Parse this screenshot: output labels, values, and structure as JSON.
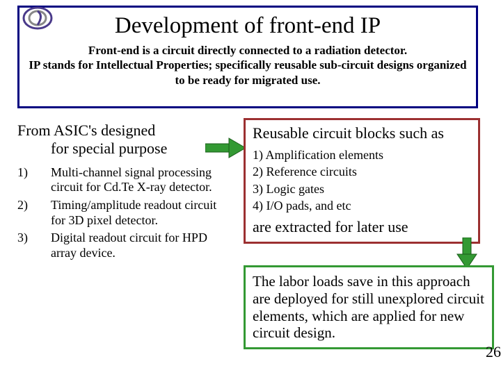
{
  "title": "Development of front-end IP",
  "subtitle": "Front-end is a circuit directly connected to a radiation detector.\nIP stands for Intellectual Properties; specifically reusable sub-circuit designs organized to be ready for migrated use.",
  "left": {
    "heading_l1": "From ASIC's designed",
    "heading_l2": "for special purpose",
    "items": [
      {
        "num": "1)",
        "text": "Multi-channel signal processing circuit for Cd.Te X-ray detector."
      },
      {
        "num": "2)",
        "text": " Timing/amplitude readout circuit for 3D pixel detector."
      },
      {
        "num": "3)",
        "text": "Digital readout circuit for HPD array device."
      }
    ]
  },
  "right": {
    "heading": "Reusable circuit blocks such as",
    "items": [
      "1) Amplification elements",
      "2) Reference circuits",
      "3) Logic gates",
      "4) I/O pads, and etc"
    ],
    "extracted": "are extracted for later use"
  },
  "labor": "The labor loads  save in this approach are deployed for still unexplored circuit elements, which are applied  for new circuit design.",
  "pagenum": "26"
}
